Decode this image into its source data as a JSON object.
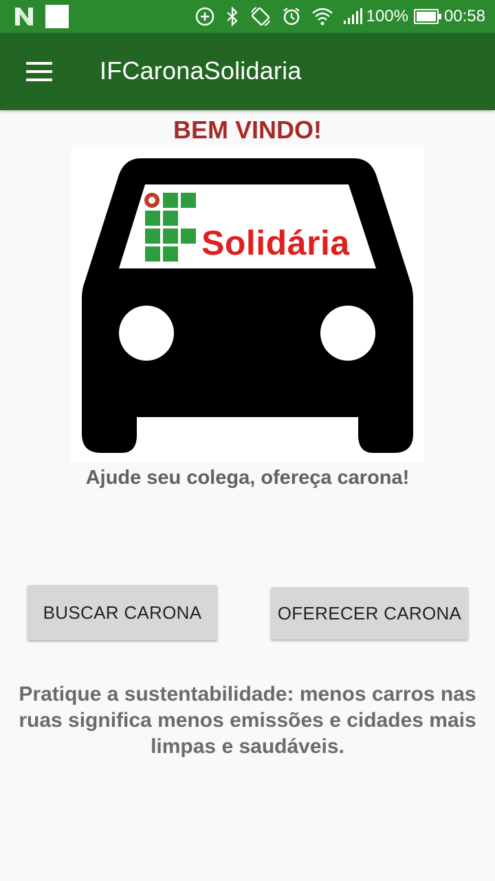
{
  "status_bar": {
    "battery": "100%",
    "time": "00:58",
    "icons": [
      "n-logo-icon",
      "notification-square-icon",
      "data-saver-icon",
      "bluetooth-icon",
      "rotate-icon",
      "alarm-icon",
      "wifi-icon",
      "signal-icon",
      "battery-icon"
    ]
  },
  "app_bar": {
    "title": "IFCaronaSolidaria",
    "menu_icon": "hamburger-menu-icon"
  },
  "main": {
    "welcome": "BEM VINDO!",
    "logo_text": "Solidária",
    "tagline": "Ajude seu colega, ofereça carona!",
    "buttons": {
      "search_label": "BUSCAR CARONA",
      "offer_label": "OFERECER CARONA"
    },
    "footer": "Pratique a sustentabilidade: menos carros nas ruas significa menos emissões e cidades mais limpas e saudáveis."
  },
  "colors": {
    "status_bar": "#2b8a2e",
    "app_bar": "#236523",
    "welcome_text": "#a52a2a",
    "logo_red": "#e02020",
    "logo_green": "#2f9e3e",
    "button_bg": "#d7d7d7"
  }
}
